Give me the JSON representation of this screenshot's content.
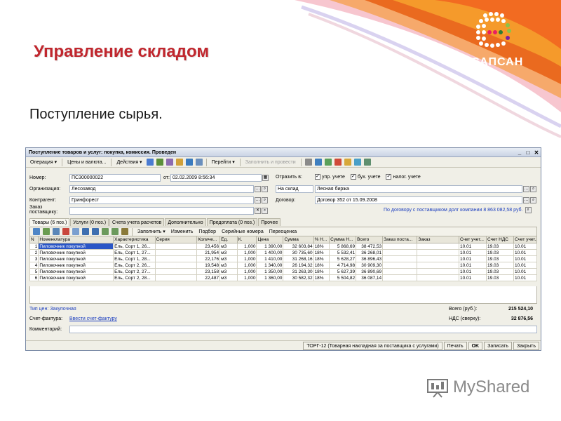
{
  "slide": {
    "title": "Управление складом",
    "subtitle": "Поступление сырья.",
    "logo_text": "САПСАН",
    "watermark": "MyShared"
  },
  "window": {
    "title": "Поступление товаров и услуг: покупка, комиссия. Проведен",
    "controls": [
      "_",
      "□",
      "✕"
    ]
  },
  "toolbar": {
    "items": [
      "Операция ▾",
      "Цены и валюта...",
      "Действия ▾",
      "Перейти ▾"
    ],
    "fill_and_post": "Заполнить и провести"
  },
  "header_fields": {
    "number_label": "Номер:",
    "number_value": "ПС300000022",
    "date_label": "от:",
    "date_value": "02.02.2009 8:56:34",
    "org_label": "Организация:",
    "org_value": "Лесозавод",
    "contractor_label": "Контрагент:",
    "contractor_value": "Гринфорест",
    "order_label_1": "Заказ",
    "order_label_2": "поставщику:",
    "order_value": "",
    "reflect_label": "Отразить в:",
    "reflect_mgmt": "упр. учете",
    "reflect_acc": "бух. учете",
    "reflect_tax": "налог. учете",
    "warehouse_value": "На склад",
    "warehouse_name": "Лесная биржа",
    "contract_label": "Договор:",
    "contract_value": "Договор 352 от 15.09.2008",
    "debt_text": "По договору с поставщиком долг компании 8 863 082,58 руб."
  },
  "tabs": [
    "Товары (6 поз.)",
    "Услуги (0 поз.)",
    "Счета учета расчетов",
    "Дополнительно",
    "Предоплата (0 поз.)",
    "Прочее"
  ],
  "grid_toolbar": {
    "fill": "Заполнить ▾",
    "change": "Изменить",
    "select": "Подбор",
    "serials": "Серийные номера",
    "recount": "Переоценка"
  },
  "table": {
    "columns": [
      "N",
      "Номенклатура",
      "Характеристика",
      "Серия",
      "Количе...",
      "Ед.",
      "К.",
      "Цена",
      "Сумма",
      "% Н...",
      "Сумма Н...",
      "Всего",
      "Заказ поста...",
      "Заказ",
      "Счет учет...",
      "Счет НДС",
      "Счет учет..."
    ],
    "rows": [
      [
        "1",
        "Пиловочник покупной",
        "Ель, Сорт 1, 26...",
        "",
        "23,456",
        "м3",
        "1,000",
        "1 390,00",
        "32 603,84",
        "18%",
        "5 868,69",
        "38 472,53",
        "",
        "",
        "10.01",
        "19.03",
        "10.01"
      ],
      [
        "2",
        "Пиловочник покупной",
        "Ель, Сорт 1, 27...",
        "",
        "21,954",
        "м3",
        "1,000",
        "1 400,00",
        "30 735,60",
        "18%",
        "5 532,41",
        "36 268,01",
        "",
        "",
        "10.01",
        "19.03",
        "10.01"
      ],
      [
        "3",
        "Пиловочник покупной",
        "Ель, Сорт 1, 28...",
        "",
        "22,176",
        "м3",
        "1,000",
        "1 410,00",
        "31 268,16",
        "18%",
        "5 628,27",
        "36 896,43",
        "",
        "",
        "10.01",
        "19.03",
        "10.01"
      ],
      [
        "4",
        "Пиловочник покупной",
        "Ель, Сорт 2, 26...",
        "",
        "19,548",
        "м3",
        "1,000",
        "1 340,00",
        "26 194,32",
        "18%",
        "4 714,98",
        "30 909,30",
        "",
        "",
        "10.01",
        "19.03",
        "10.01"
      ],
      [
        "5",
        "Пиловочник покупной",
        "Ель, Сорт 2, 27...",
        "",
        "23,158",
        "м3",
        "1,000",
        "1 350,00",
        "31 263,30",
        "18%",
        "5 627,39",
        "36 890,69",
        "",
        "",
        "10.01",
        "19.03",
        "10.01"
      ],
      [
        "6",
        "Пиловочник покупной",
        "Ель, Сорт 2, 28...",
        "",
        "22,487",
        "м3",
        "1,000",
        "1 360,00",
        "30 582,32",
        "18%",
        "5 504,82",
        "36 087,14",
        "",
        "",
        "10.01",
        "19.03",
        "10.01"
      ]
    ]
  },
  "footer": {
    "price_type": "Тип цен: Закупочная",
    "total_label": "Всего (руб.):",
    "total_value": "215 524,10",
    "invoice_label": "Счет-фактура:",
    "invoice_link": "Ввести счет-фактуру",
    "vat_label": "НДС (сверху):",
    "vat_value": "32 876,56",
    "comment_label": "Комментарий:",
    "comment_value": ""
  },
  "bottom_buttons": {
    "torg12": "ТОРГ-12 (Товарная накладная за поставщика с услугами)",
    "print": "Печать",
    "ok": "OK",
    "save": "Записать",
    "close": "Закрыть"
  },
  "colors": {
    "title_red": "#c0262d",
    "selection_blue": "#2a56c6",
    "link_blue": "#1d3fbf"
  }
}
